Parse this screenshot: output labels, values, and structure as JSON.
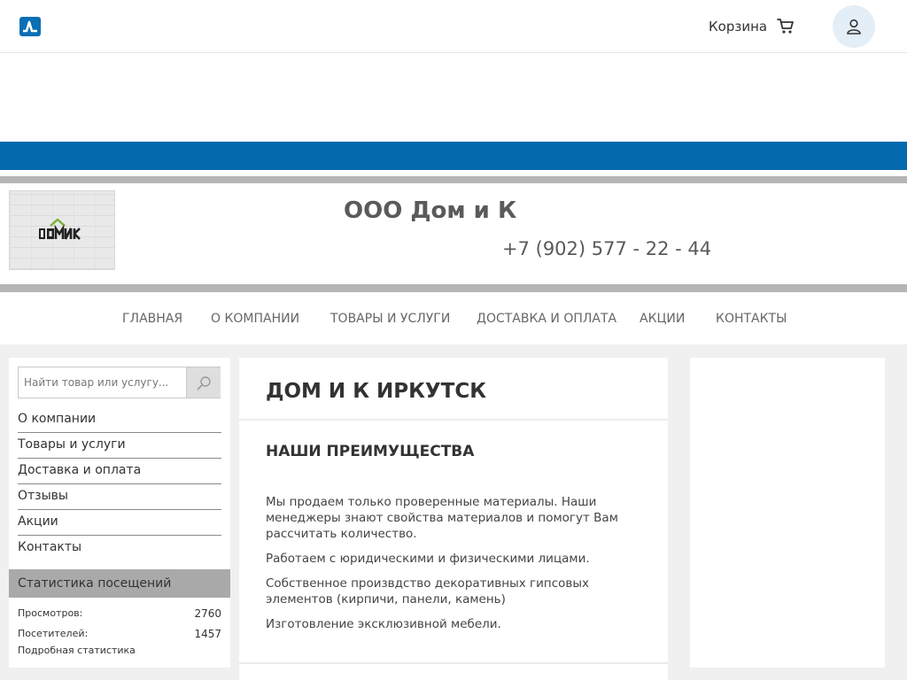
{
  "topbar": {
    "logo_icon": "site-logo-icon",
    "cart_label": "Корзина",
    "cart_icon": "cart-icon",
    "user_icon": "user-icon"
  },
  "brand": {
    "logo_text": "ДОМиК",
    "company_name": "ООО Дом и К",
    "phone": "+7 (902) 577 - 22 - 44"
  },
  "nav": {
    "items": [
      {
        "label": "Главная"
      },
      {
        "label": "О компании"
      },
      {
        "label": "Товары и услуги"
      },
      {
        "label": "Доставка и оплата"
      },
      {
        "label": "Акции"
      },
      {
        "label": "Контакты"
      }
    ]
  },
  "sidebar": {
    "search": {
      "placeholder": "Найти товар или услугу...",
      "value": ""
    },
    "menu": [
      {
        "label": "О компании"
      },
      {
        "label": "Товары и услуги"
      },
      {
        "label": "Доставка и оплата"
      },
      {
        "label": "Отзывы"
      },
      {
        "label": "Акции"
      },
      {
        "label": "Контакты"
      }
    ],
    "stats": {
      "title": "Статистика посещений",
      "views_label": "Просмотров:",
      "views_value": "2760",
      "visitors_label": "Посетителей:",
      "visitors_value": "1457",
      "detailed_link": "Подробная статистика"
    }
  },
  "main": {
    "title": "ДОМ И К ИРКУТСК",
    "section_title": "НАШИ ПРЕИМУЩЕСТВА",
    "paragraphs": [
      "Мы продаем только проверенные материалы. Наши менеджеры знают свойства материалов и помогут Вам рассчитать количество.",
      "Работаем с юридическими  и физическими лицами.",
      "Собственное произвдство декоративных гипсовых элементов (кирпичи, панели, камень)",
      "Изготовление эксклюзивной мебели."
    ]
  },
  "colors": {
    "accent_blue": "#046aae",
    "band_grey": "#b5b5b5",
    "stats_header": "#a9a9a9",
    "page_bg": "#f0f0f0",
    "logo_green": "#7bb03b"
  }
}
